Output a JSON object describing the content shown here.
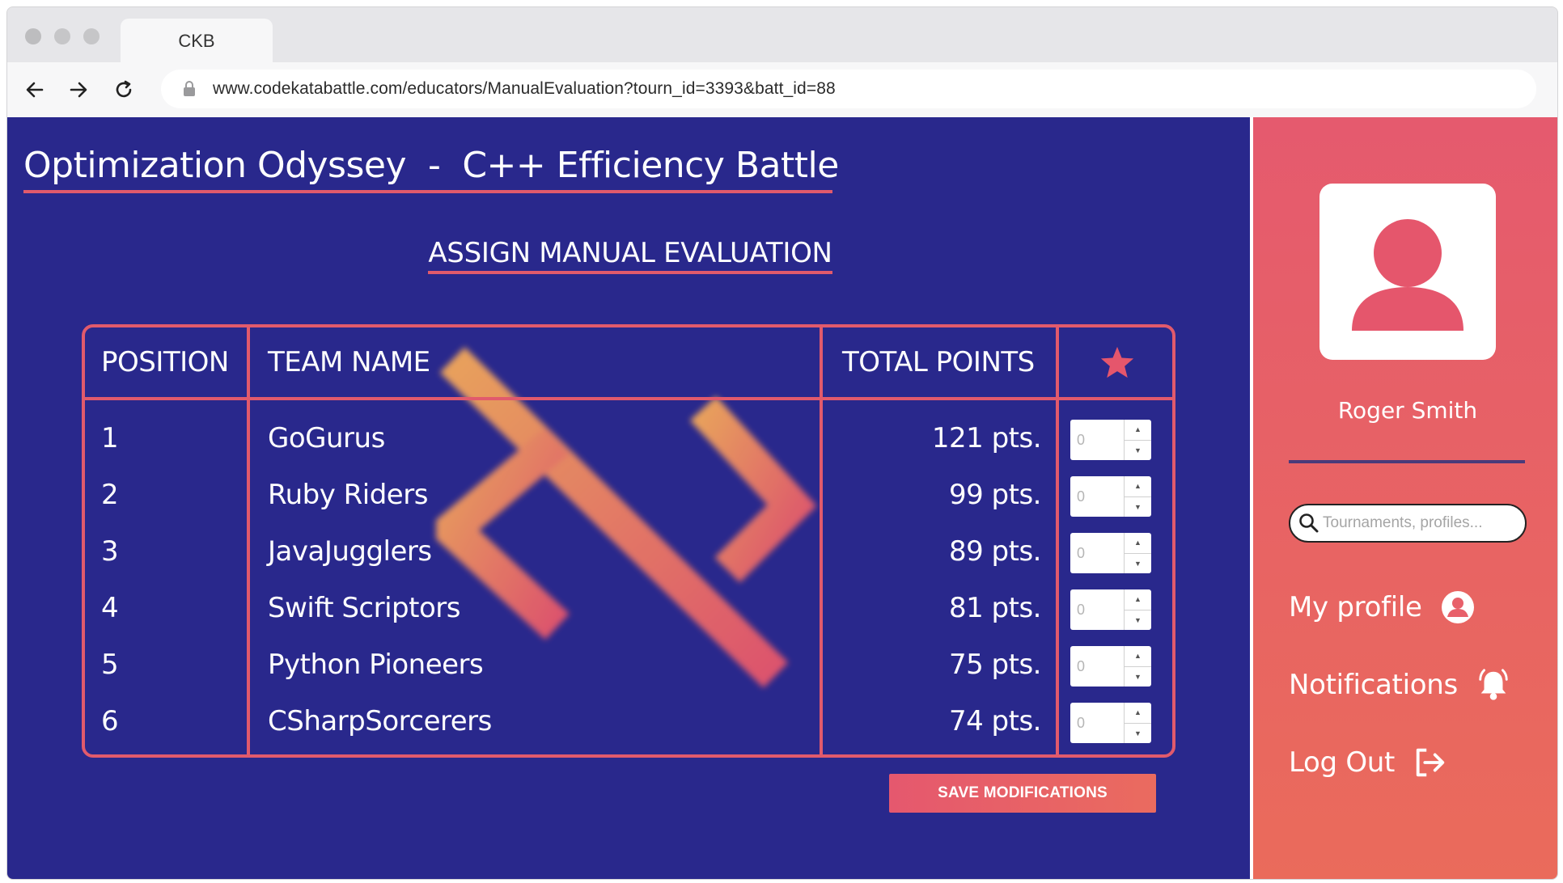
{
  "browser": {
    "tab_title": "CKB",
    "url": "www.codekatabattle.com/educators/ManualEvaluation?tourn_id=3393&batt_id=88"
  },
  "header": {
    "title": "Optimization Odyssey  -  C++ Efficiency Battle",
    "battle_icon": "scoreboard-calendar-icon"
  },
  "section_title": "ASSIGN MANUAL EVALUATION",
  "table": {
    "columns": [
      "POSITION",
      "TEAM NAME",
      "TOTAL POINTS",
      "star-icon"
    ],
    "rows": [
      {
        "position": "1",
        "team": "GoGurus",
        "points": "121 pts.",
        "manual": "0"
      },
      {
        "position": "2",
        "team": "Ruby Riders",
        "points": "99 pts.",
        "manual": "0"
      },
      {
        "position": "3",
        "team": "JavaJugglers",
        "points": "89 pts.",
        "manual": "0"
      },
      {
        "position": "4",
        "team": "Swift Scriptors",
        "points": "81 pts.",
        "manual": "0"
      },
      {
        "position": "5",
        "team": "Python Pioneers",
        "points": "75 pts.",
        "manual": "0"
      },
      {
        "position": "6",
        "team": "CSharpSorcerers",
        "points": "74 pts.",
        "manual": "0"
      }
    ]
  },
  "save_button": "SAVE MODIFICATIONS",
  "sidebar": {
    "user_name": "Roger Smith",
    "search_placeholder": "Tournaments, profiles...",
    "nav": [
      {
        "label": "My profile",
        "icon": "user-circle-icon"
      },
      {
        "label": "Notifications",
        "icon": "bell-icon"
      },
      {
        "label": "Log Out",
        "icon": "logout-icon"
      }
    ]
  },
  "colors": {
    "main_bg": "#29288c",
    "accent": "#e15a6c",
    "sidebar_gradient_top": "#e55a6e",
    "sidebar_gradient_bottom": "#ea6b5b"
  }
}
